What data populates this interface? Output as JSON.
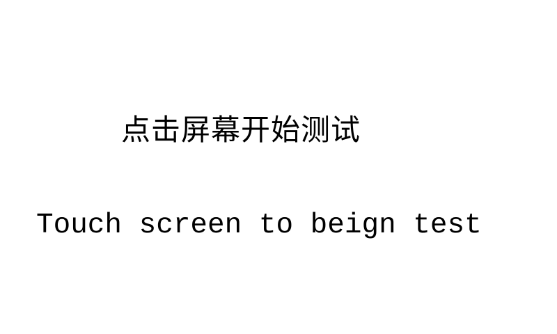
{
  "screen": {
    "prompt_cn": "点击屏幕开始测试",
    "prompt_en": "Touch screen to beign test",
    "background_color": "#ffffff",
    "text_color": "#000000"
  }
}
